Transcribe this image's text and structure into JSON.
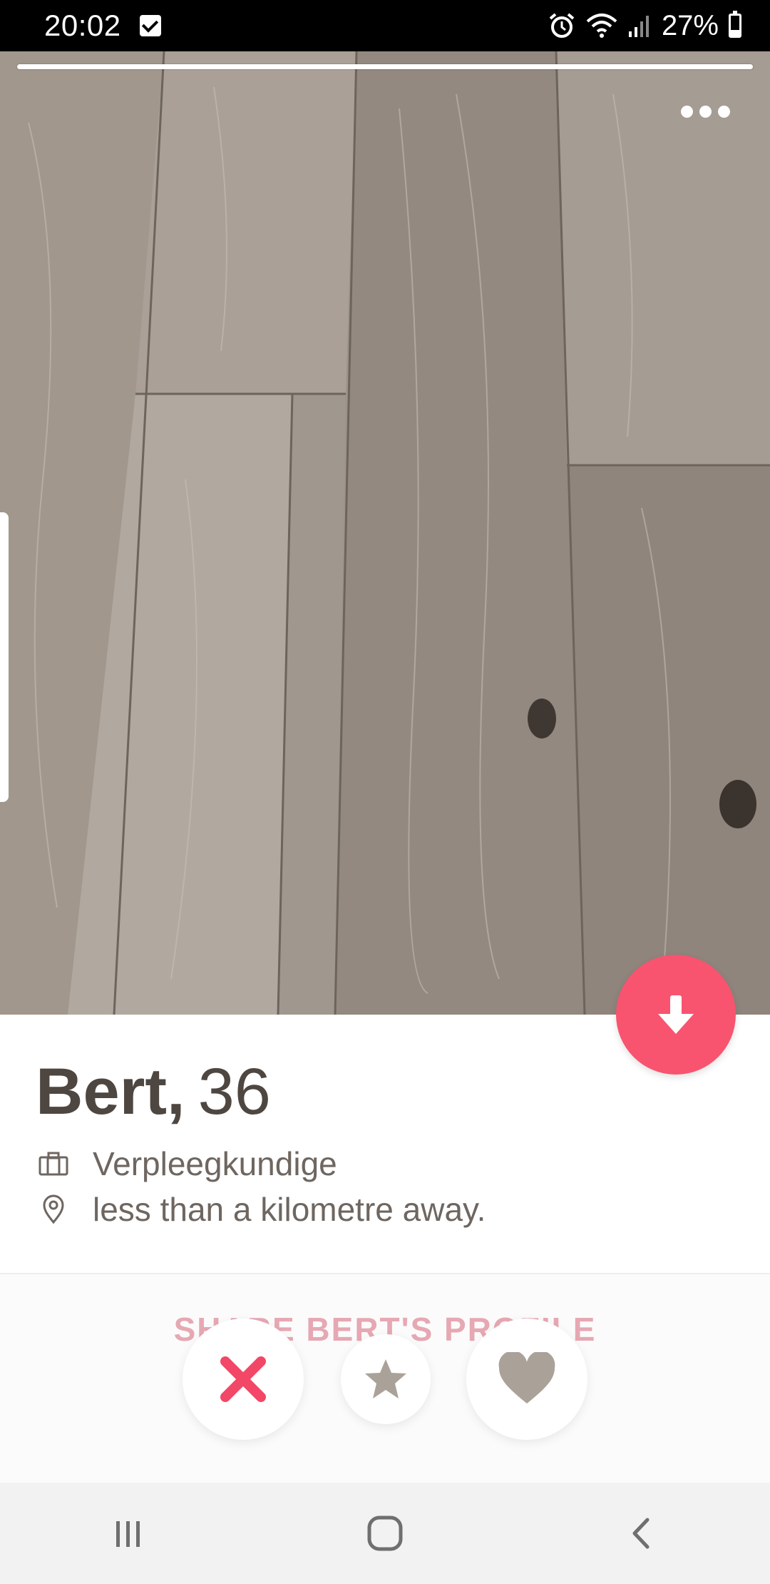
{
  "status_bar": {
    "time": "20:02",
    "battery_percent": "27%",
    "battery_level": 0.27
  },
  "photo": {
    "progress_fraction": 1.0,
    "more_icon": "more-dots-icon",
    "info_icon": "arrow-down-icon"
  },
  "profile": {
    "name": "Bert,",
    "age": "36",
    "job": "Verpleegkundige",
    "distance": "less than a kilometre away."
  },
  "share_label": "SHARE BERT'S PROFILE",
  "actions": {
    "nope_icon": "x-icon",
    "super_like_icon": "star-icon",
    "like_icon": "heart-icon"
  },
  "colors": {
    "accent": "#f8546f",
    "nope": "#f24767",
    "action_gray": "#aaa198",
    "share_text": "#e6a8b3"
  },
  "nav": [
    "recents-icon",
    "home-icon",
    "back-icon"
  ]
}
